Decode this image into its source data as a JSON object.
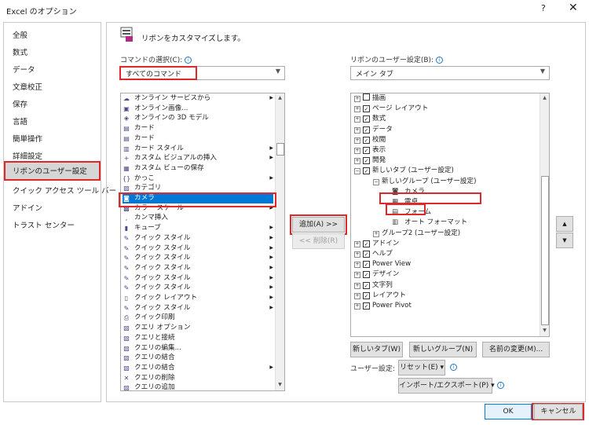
{
  "window": {
    "title": "Excel のオプション",
    "help": "?",
    "close": "✕"
  },
  "nav": {
    "items": [
      {
        "label": "全般"
      },
      {
        "label": "数式"
      },
      {
        "label": "データ"
      },
      {
        "label": "文章校正"
      },
      {
        "label": "保存"
      },
      {
        "label": "言語"
      },
      {
        "label": "簡単操作"
      },
      {
        "label": "詳細設定"
      },
      {
        "label": "リボンのユーザー設定",
        "selected": true
      },
      {
        "label": "クイック アクセス ツール バー"
      },
      {
        "label": "アドイン"
      },
      {
        "label": "トラスト センター"
      }
    ]
  },
  "header": {
    "text": "リボンをカスタマイズします。"
  },
  "commands": {
    "label": "コマンドの選択(C):",
    "selected": "すべてのコマンド",
    "items": [
      {
        "label": "オンライン サービスから",
        "icon": "online-icon",
        "sub": true
      },
      {
        "label": "オンライン画像...",
        "icon": "picture-icon"
      },
      {
        "label": "オンラインの 3D モデル",
        "icon": "model3d-icon"
      },
      {
        "label": "カード",
        "icon": "card-icon"
      },
      {
        "label": "カード",
        "icon": "card-icon"
      },
      {
        "label": "カード スタイル",
        "icon": "card-style-icon",
        "sub": true
      },
      {
        "label": "カスタム ビジュアルの挿入",
        "icon": "plus-icon",
        "sub": true
      },
      {
        "label": "カスタム ビューの保存",
        "icon": "view-icon"
      },
      {
        "label": "かっこ",
        "icon": "bracket-icon",
        "sub": true
      },
      {
        "label": "カテゴリ",
        "icon": "category-icon"
      },
      {
        "label": "カメラ",
        "icon": "camera-icon",
        "selected": true
      },
      {
        "label": "カラー スケール",
        "icon": "color-scale-icon",
        "sub": true
      },
      {
        "label": "カンマ挿入",
        "icon": "comma-icon"
      },
      {
        "label": "キューブ",
        "icon": "cube-icon",
        "sub": true
      },
      {
        "label": "クイック スタイル",
        "icon": "quick-style-icon",
        "sub": true
      },
      {
        "label": "クイック スタイル",
        "icon": "quick-style-icon",
        "sub": true
      },
      {
        "label": "クイック スタイル",
        "icon": "quick-style-icon",
        "sub": true
      },
      {
        "label": "クイック スタイル",
        "icon": "quick-style-icon",
        "sub": true
      },
      {
        "label": "クイック スタイル",
        "icon": "quick-style-icon",
        "sub": true
      },
      {
        "label": "クイック スタイル",
        "icon": "quick-style-icon",
        "sub": true
      },
      {
        "label": "クイック レイアウト",
        "icon": "quick-layout-icon",
        "sub": true
      },
      {
        "label": "クイック スタイル",
        "icon": "quick-style-icon",
        "sub": true
      },
      {
        "label": "クイック印刷",
        "icon": "print-icon"
      },
      {
        "label": "クエリ オプション",
        "icon": "query-icon"
      },
      {
        "label": "クエリと接続",
        "icon": "query-icon"
      },
      {
        "label": "クエリの編集...",
        "icon": "query-icon"
      },
      {
        "label": "クエリの結合",
        "icon": "query-icon"
      },
      {
        "label": "クエリの結合",
        "icon": "query-icon",
        "sub": true
      },
      {
        "label": "クエリの削除",
        "icon": "delete-icon"
      },
      {
        "label": "クエリの追加",
        "icon": "query-icon"
      }
    ]
  },
  "actions": {
    "add": "追加(A) >>",
    "remove": "<< 削除(R)"
  },
  "ribbon": {
    "label": "リボンのユーザー設定(B):",
    "selected": "メイン タブ",
    "tree": [
      {
        "label": "描画",
        "level": 0,
        "exp": "+",
        "check": false
      },
      {
        "label": "ページ レイアウト",
        "level": 0,
        "exp": "+",
        "check": true
      },
      {
        "label": "数式",
        "level": 0,
        "exp": "+",
        "check": true
      },
      {
        "label": "データ",
        "level": 0,
        "exp": "+",
        "check": true
      },
      {
        "label": "校閲",
        "level": 0,
        "exp": "+",
        "check": true
      },
      {
        "label": "表示",
        "level": 0,
        "exp": "+",
        "check": true
      },
      {
        "label": "開発",
        "level": 0,
        "exp": "+",
        "check": true
      },
      {
        "label": "新しいタブ (ユーザー設定)",
        "level": 0,
        "exp": "−",
        "check": true
      },
      {
        "label": "新しいグループ (ユーザー設定)",
        "level": 1,
        "exp": "−"
      },
      {
        "label": "カメラ",
        "level": 2,
        "icon": "camera-icon"
      },
      {
        "label": "電卓",
        "level": 2,
        "icon": "calculator-icon"
      },
      {
        "label": "フォーム",
        "level": 2,
        "icon": "form-icon"
      },
      {
        "label": "オート フォーマット",
        "level": 2,
        "icon": "autoformat-icon"
      },
      {
        "label": "グループ2 (ユーザー設定)",
        "level": 1,
        "exp": "+"
      },
      {
        "label": "アドイン",
        "level": 0,
        "exp": "+",
        "check": true
      },
      {
        "label": "ヘルプ",
        "level": 0,
        "exp": "+",
        "check": true
      },
      {
        "label": "Power View",
        "level": 0,
        "exp": "+",
        "check": true
      },
      {
        "label": "デザイン",
        "level": 0,
        "exp": "+",
        "check": true
      },
      {
        "label": "文字列",
        "level": 0,
        "exp": "+",
        "check": true
      },
      {
        "label": "レイアウト",
        "level": 0,
        "exp": "+",
        "check": true
      },
      {
        "label": "Power Pivot",
        "level": 0,
        "exp": "+",
        "check": true
      }
    ]
  },
  "ribbon_buttons": {
    "new_tab": "新しいタブ(W)",
    "new_group": "新しいグループ(N)",
    "rename": "名前の変更(M)...",
    "user_settings_label": "ユーザー設定:",
    "reset": "リセット(E) ▾",
    "import_export": "インポート/エクスポート(P) ▾",
    "move_up": "▲",
    "move_down": "▼"
  },
  "footer": {
    "ok": "OK",
    "cancel": "キャンセル"
  }
}
